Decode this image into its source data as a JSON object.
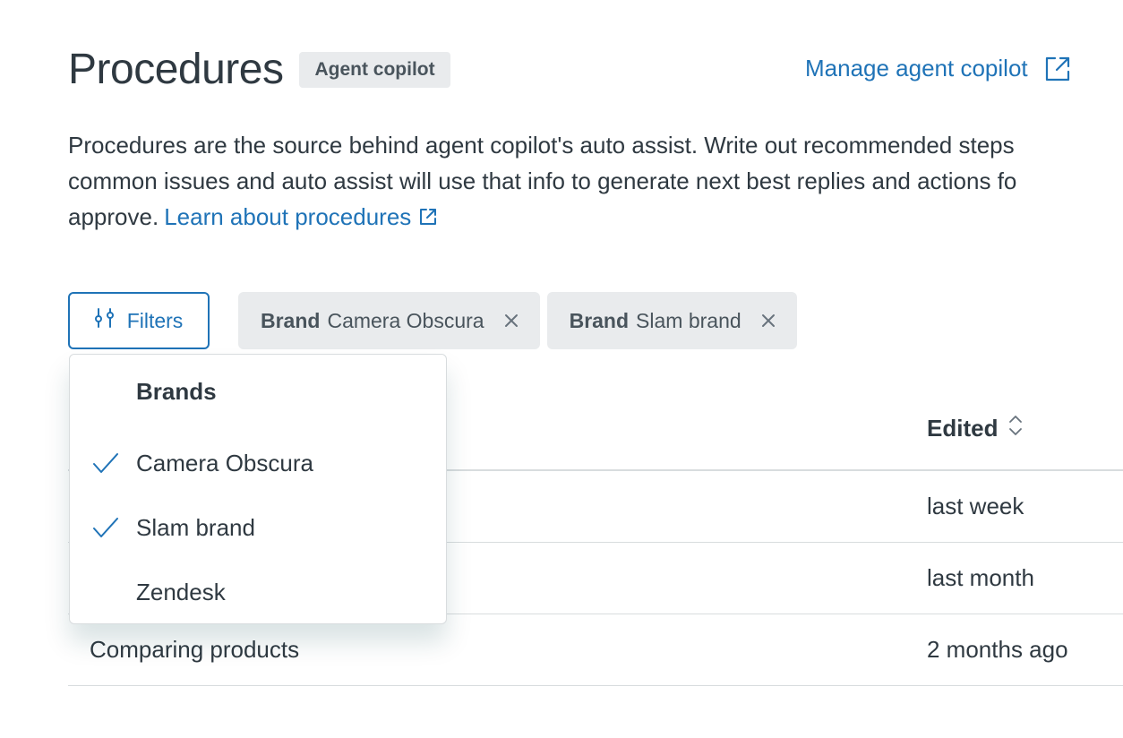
{
  "header": {
    "title": "Procedures",
    "tag": "Agent copilot",
    "manage_link": "Manage agent copilot"
  },
  "description": {
    "line1": "Procedures are the source behind agent copilot's auto assist. Write out recommended steps",
    "line2": "common issues and auto assist will use that info to generate next best replies and actions fo",
    "line3": "approve.",
    "learn_link": "Learn about procedures"
  },
  "toolbar": {
    "filters_label": "Filters",
    "chips": [
      {
        "key": "Brand",
        "value": "Camera Obscura"
      },
      {
        "key": "Brand",
        "value": "Slam brand"
      }
    ]
  },
  "dropdown": {
    "group_title": "Brands",
    "items": [
      {
        "label": "Camera Obscura",
        "checked": true
      },
      {
        "label": "Slam brand",
        "checked": true
      },
      {
        "label": "Zendesk",
        "checked": false
      }
    ]
  },
  "table": {
    "edited_header": "Edited",
    "rows": [
      {
        "name": "",
        "edited": "last week"
      },
      {
        "name": "",
        "edited": "last month"
      },
      {
        "name": "Comparing products",
        "edited": "2 months ago"
      }
    ]
  },
  "colors": {
    "link_blue": "#1f73b7",
    "text": "#2f3941",
    "chip_bg": "#e9ebed",
    "border": "#d8dcde"
  },
  "icons": {
    "external": "external-link-icon",
    "filters": "sliders-icon",
    "close": "close-icon",
    "check": "check-icon",
    "sort": "sort-icon"
  }
}
